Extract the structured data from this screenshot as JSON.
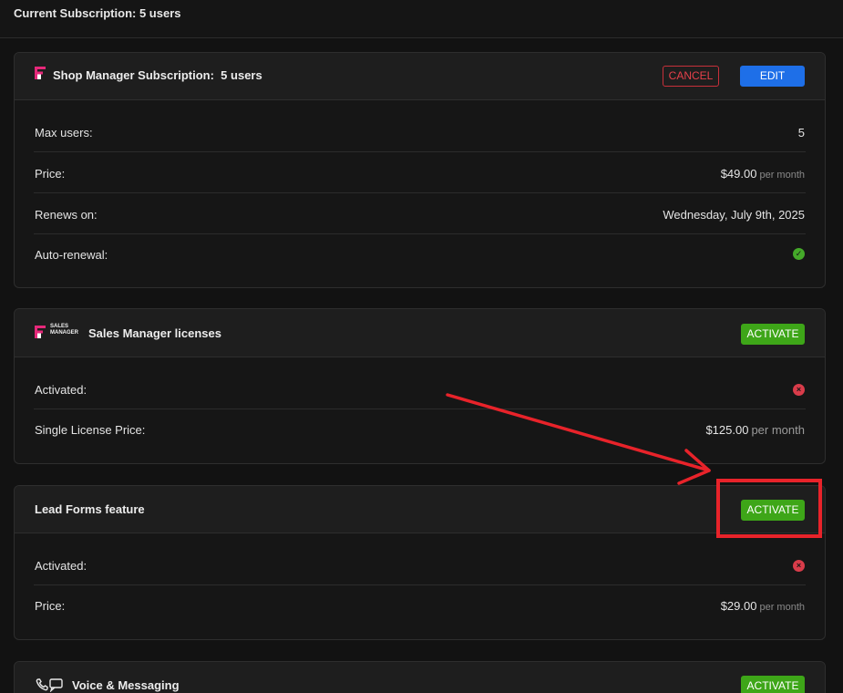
{
  "header": {
    "title": "Current Subscription: 5 users"
  },
  "shop_manager": {
    "title": "Shop Manager Subscription:  5 users",
    "logo_icon": "shop-manager-logo",
    "cancel_label": "CANCEL",
    "edit_label": "EDIT",
    "rows": [
      {
        "label": "Max users:",
        "value": "5"
      },
      {
        "label": "Price:",
        "value": "$49.00",
        "unit": "per month"
      },
      {
        "label": "Renews on:",
        "value": "Wednesday, July 9th, 2025"
      },
      {
        "label": "Auto-renewal:",
        "status": "enabled",
        "icon": "check-circle-icon"
      }
    ]
  },
  "sales_manager": {
    "title": "Sales Manager licenses",
    "logo_text_1": "SALES",
    "logo_text_2": "MANAGER",
    "activate_label": "ACTIVATE",
    "rows": [
      {
        "label": "Activated:",
        "status": "disabled",
        "icon": "x-circle-icon"
      },
      {
        "label": "Single License Price:",
        "value": "$125.00",
        "unit": "per month"
      }
    ]
  },
  "lead_forms": {
    "title": "Lead Forms feature",
    "activate_label": "ACTIVATE",
    "rows": [
      {
        "label": "Activated:",
        "status": "disabled",
        "icon": "x-circle-icon"
      },
      {
        "label": "Price:",
        "value": "$29.00",
        "unit": "per month"
      }
    ]
  },
  "voice": {
    "title": "Voice & Messaging",
    "icon": "phone-chat-icon",
    "activate_label": "ACTIVATE"
  },
  "annotation": {
    "arrow_color": "#e8232a",
    "highlight_color": "#e8232a"
  },
  "colors": {
    "accent_blue": "#1e6fe8",
    "activate_green": "#3ea618",
    "cancel_red": "#e5404a",
    "brand_pink": "#e6287a"
  }
}
